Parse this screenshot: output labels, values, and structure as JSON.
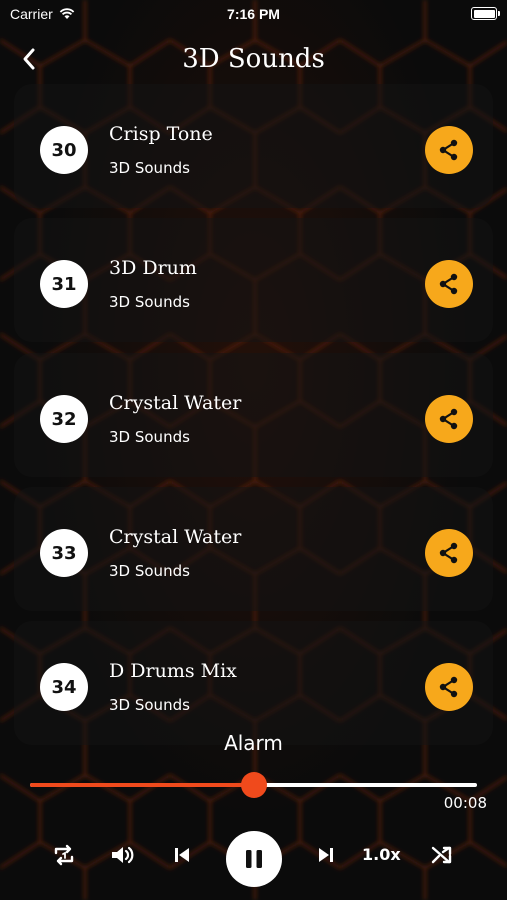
{
  "status_bar": {
    "carrier": "Carrier",
    "time": "7:16 PM"
  },
  "nav": {
    "title": "3D Sounds",
    "back_icon": "chevron-left-icon"
  },
  "colors": {
    "accent": "#f7a81b",
    "progress": "#f04a1c",
    "background": "#0b0b0b"
  },
  "sounds": [
    {
      "number": "30",
      "name": "Crisp Tone",
      "category": "3D Sounds"
    },
    {
      "number": "31",
      "name": "3D Drum",
      "category": "3D Sounds"
    },
    {
      "number": "32",
      "name": "Crystal Water",
      "category": "3D Sounds"
    },
    {
      "number": "33",
      "name": "Crystal Water",
      "category": "3D Sounds"
    },
    {
      "number": "34",
      "name": "D Drums Mix",
      "category": "3D Sounds"
    }
  ],
  "player": {
    "now_playing": "Alarm",
    "elapsed": "00:08",
    "progress_fraction": 0.5,
    "speed": "1.0x",
    "state": "playing"
  }
}
